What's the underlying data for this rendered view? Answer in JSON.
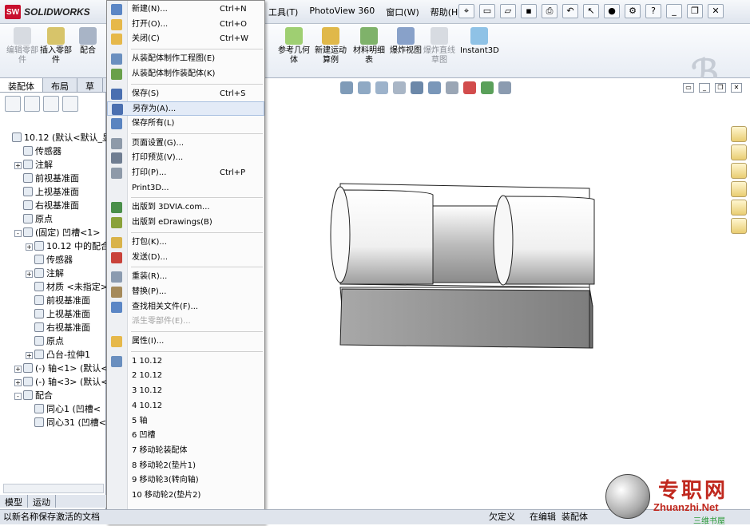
{
  "app": {
    "name": "SOLIDWORKS",
    "logo_text": "SW"
  },
  "menubar": [
    "工具(T)",
    "PhotoView 360",
    "窗口(W)",
    "帮助(H)"
  ],
  "ribbon": {
    "buttons": [
      {
        "label": "编辑零部件",
        "disabled": true
      },
      {
        "label": "插入零部件",
        "disabled": false
      },
      {
        "label": "配合",
        "disabled": false
      },
      {
        "label": "参考几何体",
        "disabled": false
      },
      {
        "label": "新建运动算例",
        "disabled": false
      },
      {
        "label": "材料明细表",
        "disabled": false
      },
      {
        "label": "爆炸视图",
        "disabled": false
      },
      {
        "label": "爆炸直线草图",
        "disabled": true
      },
      {
        "label": "Instant3D",
        "disabled": false
      }
    ]
  },
  "left_tabs": [
    "装配体",
    "布局",
    "草"
  ],
  "tree": [
    {
      "text": "10.12  (默认<默认_显",
      "indent": 0,
      "expander": ""
    },
    {
      "text": "传感器",
      "indent": 1,
      "expander": ""
    },
    {
      "text": "注解",
      "indent": 1,
      "expander": "+"
    },
    {
      "text": "前视基准面",
      "indent": 1,
      "expander": ""
    },
    {
      "text": "上视基准面",
      "indent": 1,
      "expander": ""
    },
    {
      "text": "右视基准面",
      "indent": 1,
      "expander": ""
    },
    {
      "text": "原点",
      "indent": 1,
      "expander": ""
    },
    {
      "text": "(固定) 凹槽<1>",
      "indent": 1,
      "expander": "-"
    },
    {
      "text": "10.12 中的配合",
      "indent": 2,
      "expander": "+"
    },
    {
      "text": "传感器",
      "indent": 2,
      "expander": ""
    },
    {
      "text": "注解",
      "indent": 2,
      "expander": "+"
    },
    {
      "text": "材质 <未指定>",
      "indent": 2,
      "expander": ""
    },
    {
      "text": "前视基准面",
      "indent": 2,
      "expander": ""
    },
    {
      "text": "上视基准面",
      "indent": 2,
      "expander": ""
    },
    {
      "text": "右视基准面",
      "indent": 2,
      "expander": ""
    },
    {
      "text": "原点",
      "indent": 2,
      "expander": ""
    },
    {
      "text": "凸台-拉伸1",
      "indent": 2,
      "expander": "+"
    },
    {
      "text": "(-) 轴<1> (默认<",
      "indent": 1,
      "expander": "+"
    },
    {
      "text": "(-) 轴<3> (默认<",
      "indent": 1,
      "expander": "+"
    },
    {
      "text": "配合",
      "indent": 1,
      "expander": "-"
    },
    {
      "text": "同心1 (凹槽<",
      "indent": 2,
      "expander": ""
    },
    {
      "text": "同心31 (凹槽<",
      "indent": 2,
      "expander": ""
    }
  ],
  "bottom_tabs": [
    "模型",
    "运动"
  ],
  "file_menu": [
    {
      "label": "新建(N)...",
      "shortcut": "Ctrl+N"
    },
    {
      "label": "打开(O)...",
      "shortcut": "Ctrl+O"
    },
    {
      "label": "关闭(C)",
      "shortcut": "Ctrl+W"
    },
    {
      "sep": true
    },
    {
      "label": "从装配体制作工程图(E)"
    },
    {
      "label": "从装配体制作装配体(K)"
    },
    {
      "sep": true
    },
    {
      "label": "保存(S)",
      "shortcut": "Ctrl+S"
    },
    {
      "label": "另存为(A)...",
      "highlight": true
    },
    {
      "label": "保存所有(L)"
    },
    {
      "sep": true
    },
    {
      "label": "页面设置(G)..."
    },
    {
      "label": "打印预览(V)..."
    },
    {
      "label": "打印(P)...",
      "shortcut": "Ctrl+P"
    },
    {
      "label": "Print3D..."
    },
    {
      "sep": true
    },
    {
      "label": "出版到 3DVIA.com..."
    },
    {
      "label": "出版到 eDrawings(B)"
    },
    {
      "sep": true
    },
    {
      "label": "打包(K)..."
    },
    {
      "label": "发送(D)..."
    },
    {
      "sep": true
    },
    {
      "label": "重装(R)..."
    },
    {
      "label": "替换(P)..."
    },
    {
      "label": "查找相关文件(F)..."
    },
    {
      "label": "派生零部件(E)...",
      "disabled": true
    },
    {
      "sep": true
    },
    {
      "label": "属性(I)..."
    },
    {
      "sep": true
    },
    {
      "label": "1 10.12"
    },
    {
      "label": "2 10.12"
    },
    {
      "label": "3 10.12"
    },
    {
      "label": "4 10.12"
    },
    {
      "label": "5 轴"
    },
    {
      "label": "6 凹槽"
    },
    {
      "label": "7 移动轮装配体"
    },
    {
      "label": "8 移动轮2(垫片1)"
    },
    {
      "label": "9 移动轮3(转向轴)"
    },
    {
      "label": "10 移动轮2(垫片2)"
    }
  ],
  "status": {
    "left": "以新名称保存激活的文档",
    "r1": "欠定义",
    "r2": "在编辑",
    "r3": "装配体"
  },
  "brand": {
    "cn": "专职网",
    "en": "Zhuanzhi.Net",
    "slogan": "三维书屋"
  }
}
